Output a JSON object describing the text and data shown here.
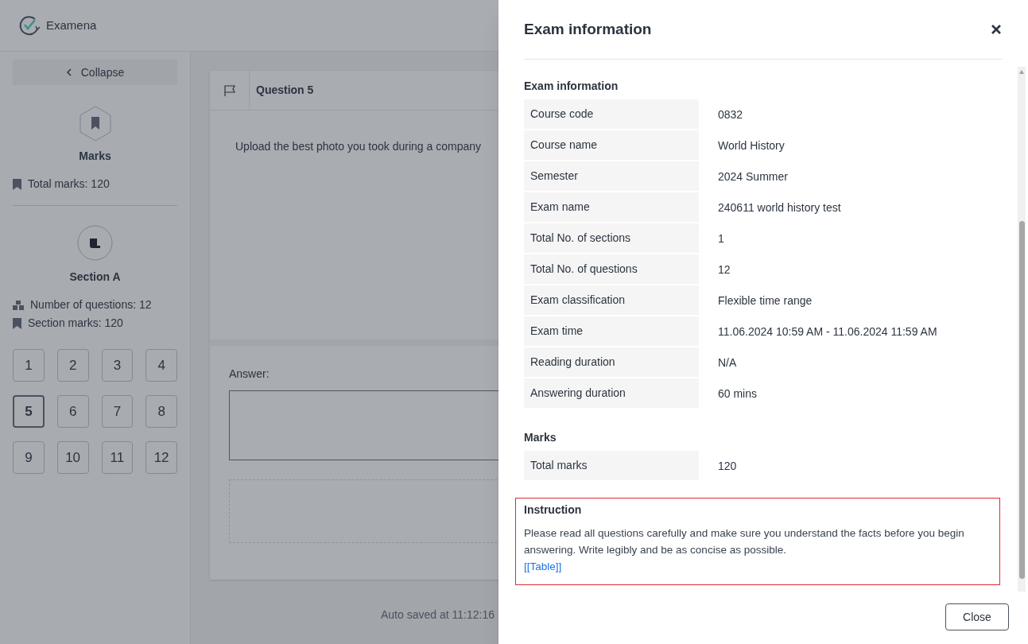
{
  "app": {
    "name": "Examena"
  },
  "sidebar": {
    "collapse_button": "Collapse",
    "marks": {
      "title": "Marks",
      "total": "Total marks: 120"
    },
    "section": {
      "title": "Section A",
      "questions_count": "Number of questions: 12",
      "section_marks": "Section marks: 120"
    },
    "questions": [
      {
        "label": "1",
        "selected": false
      },
      {
        "label": "2",
        "selected": false
      },
      {
        "label": "3",
        "selected": false
      },
      {
        "label": "4",
        "selected": false
      },
      {
        "label": "5",
        "selected": true
      },
      {
        "label": "6",
        "selected": false
      },
      {
        "label": "7",
        "selected": false
      },
      {
        "label": "8",
        "selected": false
      },
      {
        "label": "9",
        "selected": false
      },
      {
        "label": "10",
        "selected": false
      },
      {
        "label": "11",
        "selected": false
      },
      {
        "label": "12",
        "selected": false
      }
    ]
  },
  "question": {
    "title": "Question 5",
    "text": "Upload the best photo you took during a company",
    "answer_label": "Answer:"
  },
  "status": "Auto saved at 11:12:16",
  "drawer": {
    "title": "Exam information",
    "sections": [
      {
        "heading": "Exam information",
        "rows": [
          {
            "label": "Course code",
            "value": "0832"
          },
          {
            "label": "Course name",
            "value": "World History"
          },
          {
            "label": "Semester",
            "value": "2024 Summer"
          },
          {
            "label": "Exam name",
            "value": "240611 world history test"
          },
          {
            "label": "Total No. of sections",
            "value": "1"
          },
          {
            "label": "Total No. of questions",
            "value": "12"
          },
          {
            "label": "Exam classification",
            "value": "Flexible time range"
          },
          {
            "label": "Exam time",
            "value": "11.06.2024 10:59 AM - 11.06.2024 11:59 AM"
          },
          {
            "label": "Reading duration",
            "value": "N/A"
          },
          {
            "label": "Answering duration",
            "value": "60 mins"
          }
        ]
      },
      {
        "heading": "Marks",
        "rows": [
          {
            "label": "Total marks",
            "value": "120"
          }
        ]
      }
    ],
    "instruction": {
      "heading": "Instruction",
      "text": "Please read all questions carefully and make sure you understand the facts before you begin answering. Write legibly and be as concise as possible.",
      "link": "[[Table]]"
    },
    "close_button": "Close"
  }
}
